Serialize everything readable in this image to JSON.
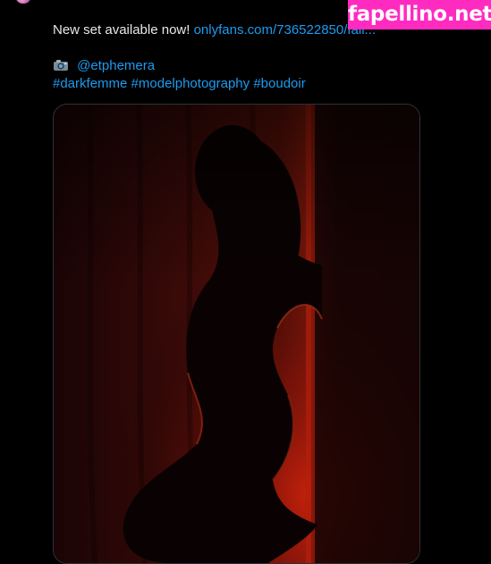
{
  "tweet": {
    "text_line1": "New set available now!",
    "link_text": "onlyfans.com/736522850/fall...",
    "credit_handle": "@etphemera",
    "hashtags": [
      "#darkfemme",
      "#modelphotography",
      "#boudoir"
    ]
  },
  "media": {
    "description_icon": "photo-icon"
  },
  "watermark": {
    "text": "fapellino.net",
    "color": "#ff2ac0"
  },
  "colors": {
    "link": "#1d9bf0",
    "background": "#000000",
    "text": "#e7e9ea"
  }
}
